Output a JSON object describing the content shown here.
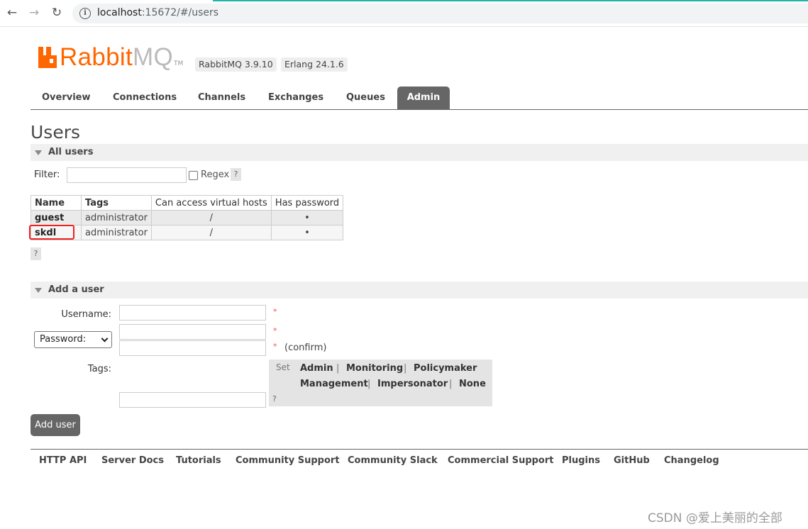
{
  "browser": {
    "url_host": "localhost",
    "url_rest": ":15672/#/users",
    "back_icon": "←",
    "forward_icon": "→",
    "reload_icon": "↻",
    "info_icon": "i"
  },
  "header": {
    "logo_rabbit": "Rabbit",
    "logo_mq": "MQ",
    "logo_tm": "TM",
    "version": "RabbitMQ 3.9.10",
    "erlang": "Erlang 24.1.6"
  },
  "tabs": [
    {
      "label": "Overview"
    },
    {
      "label": "Connections"
    },
    {
      "label": "Channels"
    },
    {
      "label": "Exchanges"
    },
    {
      "label": "Queues"
    },
    {
      "label": "Admin",
      "active": true
    }
  ],
  "page": {
    "title": "Users"
  },
  "all_users": {
    "heading": "All users",
    "filter_label": "Filter:",
    "regex_label": "Regex",
    "help": "?",
    "columns": [
      "Name",
      "Tags",
      "Can access virtual hosts",
      "Has password"
    ],
    "rows": [
      {
        "name": "guest",
        "tags": "administrator",
        "vhosts": "/",
        "has_password": "•"
      },
      {
        "name": "skdl",
        "tags": "administrator",
        "vhosts": "/",
        "has_password": "•"
      }
    ]
  },
  "add_user": {
    "heading": "Add a user",
    "username_label": "Username:",
    "password_select": "Password:",
    "required_mark": "*",
    "confirm_label": "(confirm)",
    "tags_label": "Tags:",
    "set_label": "Set",
    "tag_options": [
      "Admin",
      "Monitoring",
      "Policymaker",
      "Management",
      "Impersonator",
      "None"
    ],
    "separator": "|",
    "help": "?",
    "submit_label": "Add user"
  },
  "footer": {
    "links": [
      "HTTP API",
      "Server Docs",
      "Tutorials",
      "Community Support",
      "Community Slack",
      "Commercial Support",
      "Plugins",
      "GitHub",
      "Changelog"
    ]
  },
  "watermark": "CSDN @爱上美丽的全部",
  "colors": {
    "brand_orange": "#ff6600",
    "tab_active": "#666666",
    "highlight_red": "#ee2222"
  }
}
